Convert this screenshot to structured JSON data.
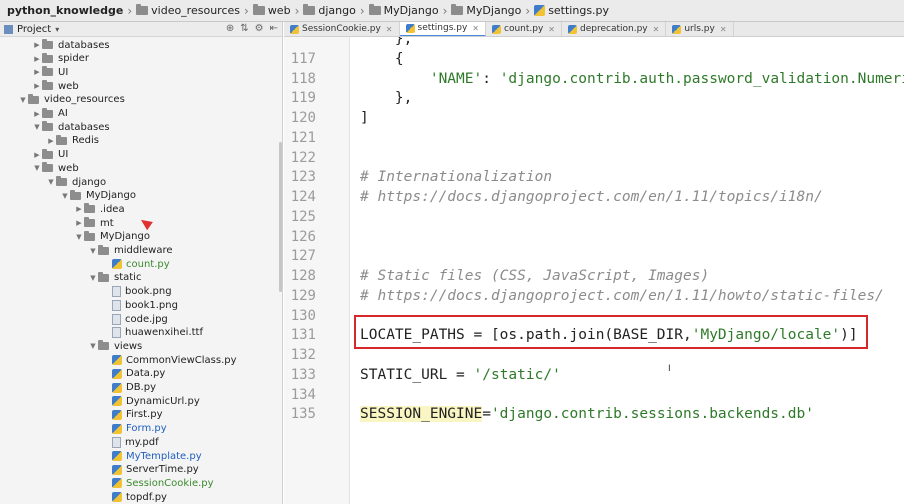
{
  "breadcrumb": [
    "python_knowledge",
    "video_resources",
    "web",
    "django",
    "MyDjango",
    "MyDjango",
    "settings.py"
  ],
  "project_panel": {
    "title": "Project"
  },
  "tree": [
    {
      "label": "databases",
      "depth": 2,
      "kind": "folder",
      "arrow": "right"
    },
    {
      "label": "spider",
      "depth": 2,
      "kind": "folder",
      "arrow": "right"
    },
    {
      "label": "UI",
      "depth": 2,
      "kind": "folder",
      "arrow": "right"
    },
    {
      "label": "web",
      "depth": 2,
      "kind": "folder",
      "arrow": "right"
    },
    {
      "label": "video_resources",
      "depth": 1,
      "kind": "folder",
      "arrow": "down"
    },
    {
      "label": "AI",
      "depth": 2,
      "kind": "folder",
      "arrow": "right"
    },
    {
      "label": "databases",
      "depth": 2,
      "kind": "folder",
      "arrow": "down"
    },
    {
      "label": "Redis",
      "depth": 3,
      "kind": "folder",
      "arrow": "right"
    },
    {
      "label": "UI",
      "depth": 2,
      "kind": "folder",
      "arrow": "right"
    },
    {
      "label": "web",
      "depth": 2,
      "kind": "folder",
      "arrow": "down"
    },
    {
      "label": "django",
      "depth": 3,
      "kind": "folder",
      "arrow": "down"
    },
    {
      "label": "MyDjango",
      "depth": 4,
      "kind": "folder",
      "arrow": "down"
    },
    {
      "label": ".idea",
      "depth": 5,
      "kind": "folder",
      "arrow": "right"
    },
    {
      "label": "mt",
      "depth": 5,
      "kind": "folder",
      "arrow": "right"
    },
    {
      "label": "MyDjango",
      "depth": 5,
      "kind": "folder",
      "arrow": "down"
    },
    {
      "label": "middleware",
      "depth": 6,
      "kind": "folder",
      "arrow": "down"
    },
    {
      "label": "count.py",
      "depth": 7,
      "kind": "py",
      "color": "green"
    },
    {
      "label": "static",
      "depth": 6,
      "kind": "folder",
      "arrow": "down"
    },
    {
      "label": "book.png",
      "depth": 7,
      "kind": "file"
    },
    {
      "label": "book1.png",
      "depth": 7,
      "kind": "file"
    },
    {
      "label": "code.jpg",
      "depth": 7,
      "kind": "file"
    },
    {
      "label": "huawenxihei.ttf",
      "depth": 7,
      "kind": "file"
    },
    {
      "label": "views",
      "depth": 6,
      "kind": "folder",
      "arrow": "down"
    },
    {
      "label": "CommonViewClass.py",
      "depth": 7,
      "kind": "py"
    },
    {
      "label": "Data.py",
      "depth": 7,
      "kind": "py"
    },
    {
      "label": "DB.py",
      "depth": 7,
      "kind": "py"
    },
    {
      "label": "DynamicUrl.py",
      "depth": 7,
      "kind": "py"
    },
    {
      "label": "First.py",
      "depth": 7,
      "kind": "py"
    },
    {
      "label": "Form.py",
      "depth": 7,
      "kind": "py",
      "color": "blue"
    },
    {
      "label": "my.pdf",
      "depth": 7,
      "kind": "file"
    },
    {
      "label": "MyTemplate.py",
      "depth": 7,
      "kind": "py",
      "color": "blue"
    },
    {
      "label": "ServerTime.py",
      "depth": 7,
      "kind": "py"
    },
    {
      "label": "SessionCookie.py",
      "depth": 7,
      "kind": "py",
      "color": "green"
    },
    {
      "label": "topdf.py",
      "depth": 7,
      "kind": "py"
    }
  ],
  "tabs": [
    {
      "label": "SessionCookie.py",
      "active": false
    },
    {
      "label": "settings.py",
      "active": true
    },
    {
      "label": "count.py",
      "active": false
    },
    {
      "label": "deprecation.py",
      "active": false
    },
    {
      "label": "urls.py",
      "active": false
    }
  ],
  "code_lines": [
    {
      "n": "",
      "segs": [
        {
          "t": "    },",
          "c": ""
        }
      ]
    },
    {
      "n": "117",
      "segs": [
        {
          "t": "    {",
          "c": ""
        }
      ]
    },
    {
      "n": "118",
      "segs": [
        {
          "t": "        ",
          "c": ""
        },
        {
          "t": "'NAME'",
          "c": "st"
        },
        {
          "t": ": ",
          "c": ""
        },
        {
          "t": "'django.contrib.auth.password_validation.Numeri",
          "c": "st"
        }
      ]
    },
    {
      "n": "119",
      "segs": [
        {
          "t": "    },",
          "c": ""
        }
      ]
    },
    {
      "n": "120",
      "segs": [
        {
          "t": "]",
          "c": ""
        }
      ]
    },
    {
      "n": "121",
      "segs": []
    },
    {
      "n": "122",
      "segs": []
    },
    {
      "n": "123",
      "segs": [
        {
          "t": "# Internationalization",
          "c": "cm"
        }
      ]
    },
    {
      "n": "124",
      "segs": [
        {
          "t": "# https://docs.djangoproject.com/en/1.11/topics/i18n/",
          "c": "cm"
        }
      ]
    },
    {
      "n": "125",
      "segs": []
    },
    {
      "n": "126",
      "segs": []
    },
    {
      "n": "127",
      "segs": []
    },
    {
      "n": "128",
      "segs": [
        {
          "t": "# Static files (CSS, JavaScript, Images)",
          "c": "cm"
        }
      ]
    },
    {
      "n": "129",
      "segs": [
        {
          "t": "# https://docs.djangoproject.com/en/1.11/howto/static-files/",
          "c": "cm"
        }
      ]
    },
    {
      "n": "130",
      "segs": []
    },
    {
      "n": "131",
      "segs": [
        {
          "t": "LOCATE_PATHS = [os.path.join(BASE_DIR,",
          "c": ""
        },
        {
          "t": "'MyDjango/locale'",
          "c": "st"
        },
        {
          "t": ")]",
          "c": ""
        }
      ]
    },
    {
      "n": "132",
      "segs": []
    },
    {
      "n": "133",
      "segs": [
        {
          "t": "STATIC_URL = ",
          "c": ""
        },
        {
          "t": "'/static/'",
          "c": "st"
        }
      ]
    },
    {
      "n": "134",
      "segs": []
    },
    {
      "n": "135",
      "segs": [
        {
          "t": "SESSION_ENGINE",
          "c": "hl"
        },
        {
          "t": "=",
          "c": ""
        },
        {
          "t": "'django.contrib.sessions.backends.db'",
          "c": "st"
        }
      ]
    }
  ]
}
